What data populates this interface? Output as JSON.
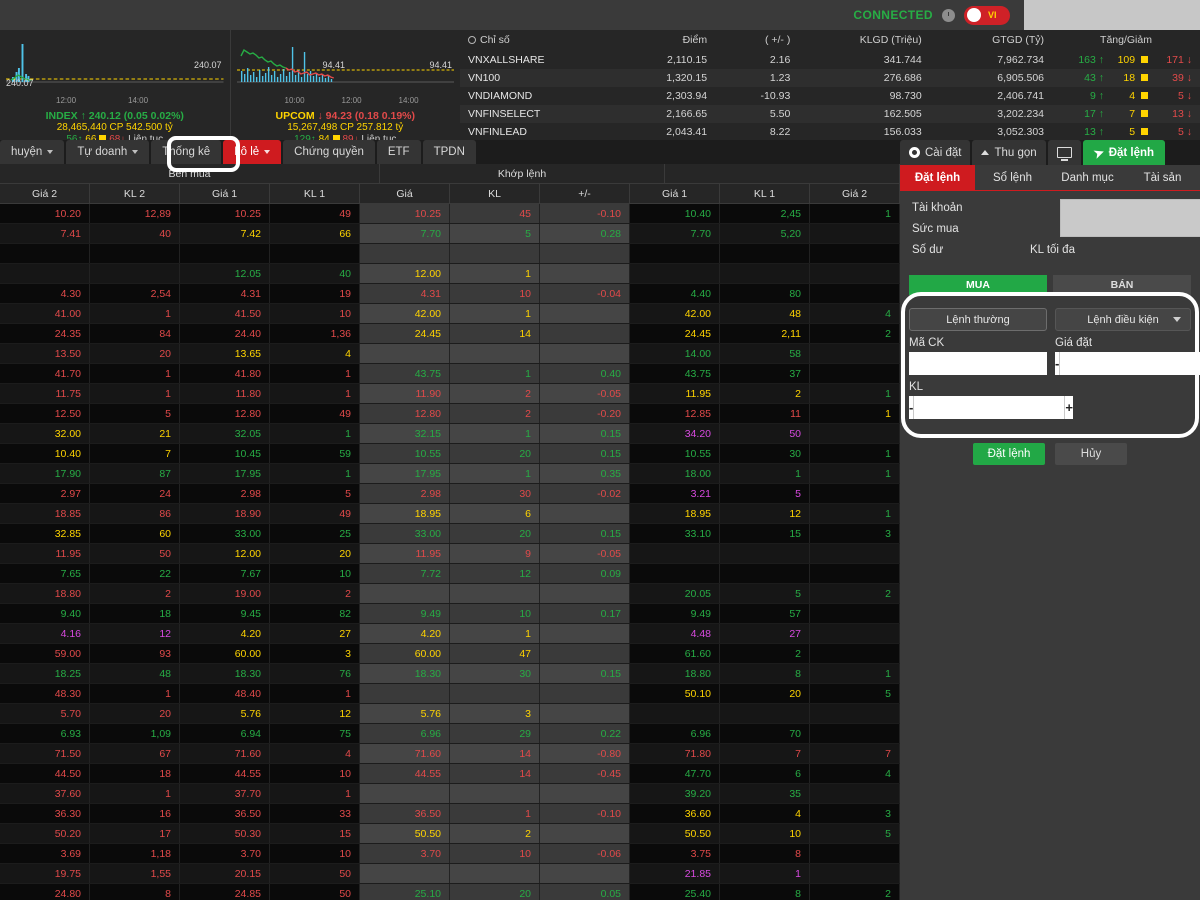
{
  "topbar": {
    "connected_label": "CONNECTED",
    "clock_icon": "clock-icon",
    "language": "VI"
  },
  "charts": [
    {
      "name": "INDEX",
      "ref_value": "240.07",
      "ref_value_right": "240.07",
      "times": [
        "12:00",
        "14:00"
      ],
      "direction": "up",
      "arrow": "↑",
      "value": "240.12",
      "change": "(0.05",
      "change_pct": "0.02%)",
      "volume": "28,465,440 CP",
      "value_traded": "542.500 tỷ",
      "adv": "56",
      "ref_count": "66",
      "dec": "68",
      "session": "Liên tục"
    },
    {
      "name": "UPCOM",
      "ref_value": "94.41",
      "ref_value_right": "94.41",
      "times": [
        "10:00",
        "12:00",
        "14:00"
      ],
      "direction": "down",
      "arrow": "↓",
      "value": "94.23",
      "change": "(0.18",
      "change_pct": "0.19%)",
      "volume": "15,267,498 CP",
      "value_traded": "257.812 tỷ",
      "adv": "129",
      "ref_count": "84",
      "dec": "89",
      "session": "Liên tục"
    }
  ],
  "index_table": {
    "headers": [
      "Chỉ số",
      "Điểm",
      "( +/- )",
      "KLGD (Triệu)",
      "GTGD (Tỷ)",
      "Tăng/Giảm"
    ],
    "gear_icon": "gear-icon",
    "rows": [
      {
        "name": "VNXALLSHARE",
        "point": "2,110.15",
        "pt_dir": "up",
        "change": "2.16",
        "ch_dir": "up",
        "klgd": "341.744",
        "gtgd": "7,962.734",
        "adv": "163",
        "ref": "109",
        "dec": "171"
      },
      {
        "name": "VN100",
        "point": "1,320.15",
        "pt_dir": "up",
        "change": "1.23",
        "ch_dir": "up",
        "klgd": "276.686",
        "gtgd": "6,905.506",
        "adv": "43",
        "ref": "18",
        "dec": "39"
      },
      {
        "name": "VNDIAMOND",
        "point": "2,303.94",
        "pt_dir": "down",
        "change": "-10.93",
        "ch_dir": "down",
        "klgd": "98.730",
        "gtgd": "2,406.741",
        "adv": "9",
        "ref": "4",
        "dec": "5"
      },
      {
        "name": "VNFINSELECT",
        "point": "2,166.65",
        "pt_dir": "up",
        "change": "5.50",
        "ch_dir": "up",
        "klgd": "162.505",
        "gtgd": "3,202.234",
        "adv": "17",
        "ref": "7",
        "dec": "13"
      },
      {
        "name": "VNFINLEAD",
        "point": "2,043.41",
        "pt_dir": "up",
        "change": "8.22",
        "ch_dir": "up",
        "klgd": "156.033",
        "gtgd": "3,052.303",
        "adv": "13",
        "ref": "5",
        "dec": "5"
      }
    ]
  },
  "market_tabs": [
    {
      "label": "huyện",
      "caret": true,
      "active": false
    },
    {
      "label": "Tự doanh",
      "caret": true,
      "active": false
    },
    {
      "label": "Thống kê",
      "caret": false,
      "active": false
    },
    {
      "label": "Lô lẻ",
      "caret": true,
      "active": true
    },
    {
      "label": "Chứng quyền",
      "caret": false,
      "active": false
    },
    {
      "label": "ETF",
      "caret": false,
      "active": false
    },
    {
      "label": "TPDN",
      "caret": false,
      "active": false
    }
  ],
  "board": {
    "group_headers": [
      {
        "label": "Bên mua",
        "span": 4
      },
      {
        "label": "Khớp lệnh",
        "span": 3
      },
      {
        "label": "",
        "span": 3
      }
    ],
    "columns": [
      "Giá 2",
      "KL 2",
      "Giá 1",
      "KL 1",
      "Giá",
      "KL",
      "+/-",
      "Giá 1",
      "KL 1",
      "Giá 2"
    ],
    "rows": [
      {
        "c": [
          "10.20",
          "12,89",
          "10.25",
          "49",
          "10.25",
          "45",
          "-0.10",
          "10.40",
          "2,45",
          "1"
        ],
        "k": [
          "dn",
          "dn",
          "dn",
          "dn",
          "dn",
          "dn",
          "dn",
          "up",
          "up",
          "up"
        ]
      },
      {
        "c": [
          "7.41",
          "40",
          "7.42",
          "66",
          "7.70",
          "5",
          "0.28",
          "7.70",
          "5,20",
          "",
          ""
        ],
        "k": [
          "dn",
          "dn",
          "ref",
          "ref",
          "up",
          "up",
          "up",
          "up",
          "up",
          ""
        ]
      },
      {
        "c": [
          "",
          "",
          "",
          "",
          "",
          "",
          "",
          "",
          "",
          ""
        ],
        "k": [
          "",
          "",
          "",
          "",
          "",
          "",
          "",
          "",
          "",
          ""
        ]
      },
      {
        "c": [
          "",
          "",
          "12.05",
          "40",
          "12.00",
          "1",
          "",
          "",
          "",
          ""
        ],
        "k": [
          "",
          "",
          "up",
          "up",
          "ref",
          "ref",
          "",
          "",
          "",
          ""
        ]
      },
      {
        "c": [
          "4.30",
          "2,54",
          "4.31",
          "19",
          "4.31",
          "10",
          "-0.04",
          "4.40",
          "80",
          ""
        ],
        "k": [
          "dn",
          "dn",
          "dn",
          "dn",
          "dn",
          "dn",
          "dn",
          "up",
          "up",
          ""
        ]
      },
      {
        "c": [
          "41.00",
          "1",
          "41.50",
          "10",
          "42.00",
          "1",
          "",
          "42.00",
          "48",
          "4"
        ],
        "k": [
          "dn",
          "dn",
          "dn",
          "dn",
          "ref",
          "ref",
          "",
          "ref",
          "ref",
          "up"
        ]
      },
      {
        "c": [
          "24.35",
          "84",
          "24.40",
          "1,36",
          "24.45",
          "14",
          "",
          "24.45",
          "2,11",
          "2"
        ],
        "k": [
          "dn",
          "dn",
          "dn",
          "dn",
          "ref",
          "ref",
          "",
          "ref",
          "ref",
          "up"
        ]
      },
      {
        "c": [
          "13.50",
          "20",
          "13.65",
          "4",
          "",
          "",
          "",
          "14.00",
          "58",
          ""
        ],
        "k": [
          "dn",
          "dn",
          "ref",
          "ref",
          "",
          "",
          "",
          "up",
          "up",
          ""
        ]
      },
      {
        "c": [
          "41.70",
          "1",
          "41.80",
          "1",
          "43.75",
          "1",
          "0.40",
          "43.75",
          "37",
          ""
        ],
        "k": [
          "dn",
          "dn",
          "dn",
          "dn",
          "up",
          "up",
          "up",
          "up",
          "up",
          ""
        ]
      },
      {
        "c": [
          "11.75",
          "1",
          "11.80",
          "1",
          "11.90",
          "2",
          "-0.05",
          "11.95",
          "2",
          "1"
        ],
        "k": [
          "dn",
          "dn",
          "dn",
          "dn",
          "dn",
          "dn",
          "dn",
          "ref",
          "ref",
          "up"
        ]
      },
      {
        "c": [
          "12.50",
          "5",
          "12.80",
          "49",
          "12.80",
          "2",
          "-0.20",
          "12.85",
          "11",
          "1"
        ],
        "k": [
          "dn",
          "dn",
          "dn",
          "dn",
          "dn",
          "dn",
          "dn",
          "dn",
          "dn",
          "ref"
        ]
      },
      {
        "c": [
          "32.00",
          "21",
          "32.05",
          "1",
          "32.15",
          "1",
          "0.15",
          "34.20",
          "50",
          ""
        ],
        "k": [
          "ref",
          "ref",
          "up",
          "up",
          "up",
          "up",
          "up",
          "ceil",
          "ceil",
          ""
        ]
      },
      {
        "c": [
          "10.40",
          "7",
          "10.45",
          "59",
          "10.55",
          "20",
          "0.15",
          "10.55",
          "30",
          "1"
        ],
        "k": [
          "ref",
          "ref",
          "up",
          "up",
          "up",
          "up",
          "up",
          "up",
          "up",
          "up"
        ]
      },
      {
        "c": [
          "17.90",
          "87",
          "17.95",
          "1",
          "17.95",
          "1",
          "0.35",
          "18.00",
          "1",
          "1"
        ],
        "k": [
          "up",
          "up",
          "up",
          "up",
          "up",
          "up",
          "up",
          "up",
          "up",
          "up"
        ]
      },
      {
        "c": [
          "2.97",
          "24",
          "2.98",
          "5",
          "2.98",
          "30",
          "-0.02",
          "3.21",
          "5",
          ""
        ],
        "k": [
          "dn",
          "dn",
          "dn",
          "dn",
          "dn",
          "dn",
          "dn",
          "ceil",
          "ceil",
          ""
        ]
      },
      {
        "c": [
          "18.85",
          "86",
          "18.90",
          "49",
          "18.95",
          "6",
          "",
          "18.95",
          "12",
          "1"
        ],
        "k": [
          "dn",
          "dn",
          "dn",
          "dn",
          "ref",
          "ref",
          "",
          "ref",
          "ref",
          "up"
        ]
      },
      {
        "c": [
          "32.85",
          "60",
          "33.00",
          "25",
          "33.00",
          "20",
          "0.15",
          "33.10",
          "15",
          "3"
        ],
        "k": [
          "ref",
          "ref",
          "up",
          "up",
          "up",
          "up",
          "up",
          "up",
          "up",
          "up"
        ]
      },
      {
        "c": [
          "11.95",
          "50",
          "12.00",
          "20",
          "11.95",
          "9",
          "-0.05",
          "",
          "",
          ""
        ],
        "k": [
          "dn",
          "dn",
          "ref",
          "ref",
          "dn",
          "dn",
          "dn",
          "",
          "",
          ""
        ]
      },
      {
        "c": [
          "7.65",
          "22",
          "7.67",
          "10",
          "7.72",
          "12",
          "0.09",
          "",
          "",
          ""
        ],
        "k": [
          "up",
          "up",
          "up",
          "up",
          "up",
          "up",
          "up",
          "",
          "",
          ""
        ]
      },
      {
        "c": [
          "18.80",
          "2",
          "19.00",
          "2",
          "",
          "",
          "",
          "20.05",
          "5",
          "2"
        ],
        "k": [
          "dn",
          "dn",
          "dn",
          "dn",
          "",
          "",
          "",
          "up",
          "up",
          "up"
        ]
      },
      {
        "c": [
          "9.40",
          "18",
          "9.45",
          "82",
          "9.49",
          "10",
          "0.17",
          "9.49",
          "57",
          ""
        ],
        "k": [
          "up",
          "up",
          "up",
          "up",
          "up",
          "up",
          "up",
          "up",
          "up",
          ""
        ]
      },
      {
        "c": [
          "4.16",
          "12",
          "4.20",
          "27",
          "4.20",
          "1",
          "",
          "4.48",
          "27",
          ""
        ],
        "k": [
          "ceil",
          "ceil",
          "ref",
          "ref",
          "ref",
          "ref",
          "",
          "ceil",
          "ceil",
          ""
        ]
      },
      {
        "c": [
          "59.00",
          "93",
          "60.00",
          "3",
          "60.00",
          "47",
          "",
          "61.60",
          "2",
          ""
        ],
        "k": [
          "dn",
          "dn",
          "ref",
          "ref",
          "ref",
          "ref",
          "",
          "up",
          "up",
          ""
        ]
      },
      {
        "c": [
          "18.25",
          "48",
          "18.30",
          "76",
          "18.30",
          "30",
          "0.15",
          "18.80",
          "8",
          "1"
        ],
        "k": [
          "up",
          "up",
          "up",
          "up",
          "up",
          "up",
          "up",
          "up",
          "up",
          "up"
        ]
      },
      {
        "c": [
          "48.30",
          "1",
          "48.40",
          "1",
          "",
          "",
          "",
          "50.10",
          "20",
          "5"
        ],
        "k": [
          "dn",
          "dn",
          "dn",
          "dn",
          "",
          "",
          "",
          "ref",
          "ref",
          "up"
        ]
      },
      {
        "c": [
          "5.70",
          "20",
          "5.76",
          "12",
          "5.76",
          "3",
          "",
          "",
          "",
          ""
        ],
        "k": [
          "dn",
          "dn",
          "ref",
          "ref",
          "ref",
          "ref",
          "",
          "",
          "",
          ""
        ]
      },
      {
        "c": [
          "6.93",
          "1,09",
          "6.94",
          "75",
          "6.96",
          "29",
          "0.22",
          "6.96",
          "70",
          ""
        ],
        "k": [
          "up",
          "up",
          "up",
          "up",
          "up",
          "up",
          "up",
          "up",
          "up",
          ""
        ]
      },
      {
        "c": [
          "71.50",
          "67",
          "71.60",
          "4",
          "71.60",
          "14",
          "-0.80",
          "71.80",
          "7",
          "7"
        ],
        "k": [
          "dn",
          "dn",
          "dn",
          "dn",
          "dn",
          "dn",
          "dn",
          "dn",
          "dn",
          "dn"
        ]
      },
      {
        "c": [
          "44.50",
          "18",
          "44.55",
          "10",
          "44.55",
          "14",
          "-0.45",
          "47.70",
          "6",
          "4"
        ],
        "k": [
          "dn",
          "dn",
          "dn",
          "dn",
          "dn",
          "dn",
          "dn",
          "up",
          "up",
          "up"
        ]
      },
      {
        "c": [
          "37.60",
          "1",
          "37.70",
          "1",
          "",
          "",
          "",
          "39.20",
          "35",
          ""
        ],
        "k": [
          "dn",
          "dn",
          "dn",
          "dn",
          "",
          "",
          "",
          "up",
          "up",
          ""
        ]
      },
      {
        "c": [
          "36.30",
          "16",
          "36.50",
          "33",
          "36.50",
          "1",
          "-0.10",
          "36.60",
          "4",
          "3"
        ],
        "k": [
          "dn",
          "dn",
          "dn",
          "dn",
          "dn",
          "dn",
          "dn",
          "ref",
          "ref",
          "up"
        ]
      },
      {
        "c": [
          "50.20",
          "17",
          "50.30",
          "15",
          "50.50",
          "2",
          "",
          "50.50",
          "10",
          "5"
        ],
        "k": [
          "dn",
          "dn",
          "dn",
          "dn",
          "ref",
          "ref",
          "",
          "ref",
          "ref",
          "up"
        ]
      },
      {
        "c": [
          "3.69",
          "1,18",
          "3.70",
          "10",
          "3.70",
          "10",
          "-0.06",
          "3.75",
          "8",
          ""
        ],
        "k": [
          "dn",
          "dn",
          "dn",
          "dn",
          "dn",
          "dn",
          "dn",
          "dn",
          "dn",
          ""
        ]
      },
      {
        "c": [
          "19.75",
          "1,55",
          "20.15",
          "50",
          "",
          "",
          "",
          "21.85",
          "1",
          ""
        ],
        "k": [
          "dn",
          "dn",
          "dn",
          "dn",
          "",
          "",
          "",
          "ceil",
          "ceil",
          ""
        ]
      },
      {
        "c": [
          "24.80",
          "8",
          "24.85",
          "50",
          "25.10",
          "20",
          "0.05",
          "25.40",
          "8",
          "2"
        ],
        "k": [
          "dn",
          "dn",
          "dn",
          "dn",
          "up",
          "up",
          "up",
          "up",
          "up",
          "up"
        ]
      }
    ]
  },
  "right_toolbar": {
    "settings_label": "Cài đặt",
    "settings_icon": "gear-icon",
    "collapse_label": "Thu gọn",
    "collapse_icon": "chevron-up-icon",
    "monitor_icon": "monitor-icon",
    "order_label": "Đặt lệnh",
    "order_icon": "paper-plane-icon"
  },
  "right_tabs": [
    {
      "label": "Đặt lệnh",
      "active": true
    },
    {
      "label": "Sổ lệnh",
      "active": false
    },
    {
      "label": "Danh mục",
      "active": false
    },
    {
      "label": "Tài sản",
      "active": false
    }
  ],
  "account": {
    "account_label": "Tài khoản",
    "buying_power_label": "Sức mua",
    "balance_label": "Số dư",
    "max_qty_label": "KL tối đa",
    "account_value": "",
    "buying_power_value": "",
    "balance_value": "",
    "max_qty_value": ""
  },
  "order_form": {
    "buy_label": "MUA",
    "sell_label": "BÁN",
    "normal_order_label": "Lệnh thường",
    "conditional_order_label": "Lệnh điều kiện",
    "symbol_label": "Mã CK",
    "symbol_value": "",
    "price_label": "Giá đặt",
    "price_value": "",
    "qty_label": "KL",
    "qty_value": "",
    "minus": "-",
    "plus": "+",
    "submit_label": "Đặt lệnh",
    "cancel_label": "Hủy"
  },
  "colors": {
    "up": "#27ad45",
    "down": "#e24a4a",
    "reference": "#ffd400",
    "ceiling": "#d94ae0",
    "floor": "#4ad0e0",
    "accent_red": "#cf1b1f",
    "accent_green": "#22a846",
    "highlight": "#ffffff"
  }
}
